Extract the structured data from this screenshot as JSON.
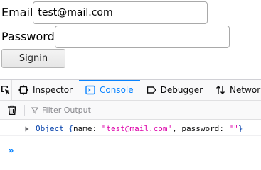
{
  "form": {
    "email_label": "Email",
    "email_value": "test@mail.com",
    "password_label": "Password",
    "password_value": "",
    "signin_label": "Signin"
  },
  "devtools": {
    "tabs": [
      {
        "label": "Inspector",
        "icon": "inspector-icon",
        "selected": false
      },
      {
        "label": "Console",
        "icon": "console-icon",
        "selected": true
      },
      {
        "label": "Debugger",
        "icon": "debugger-icon",
        "selected": false
      },
      {
        "label": "Network",
        "icon": "network-icon",
        "selected": false
      }
    ],
    "filter_placeholder": "Filter Output",
    "message": {
      "prefix": "Object { ",
      "key1": "name",
      "val1": "\"test@mail.com\"",
      "key2": "password",
      "val2": "\"\"",
      "suffix": " }"
    },
    "prompt_symbol": "»"
  },
  "colors": {
    "accent": "#0a84ff",
    "string": "#dd00a9",
    "object": "#003eaa"
  }
}
